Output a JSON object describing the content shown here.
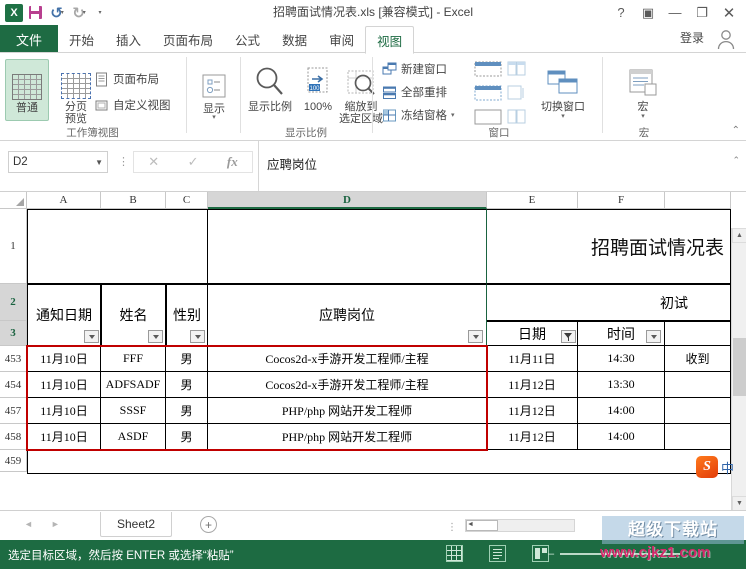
{
  "window": {
    "title": "招聘面试情况表.xls  [兼容模式] - Excel",
    "quick_access": [
      {
        "name": "save",
        "label": "保存"
      },
      {
        "name": "undo",
        "label": "撤销"
      },
      {
        "name": "redo",
        "label": "恢复"
      },
      {
        "name": "customize",
        "label": "自定义快速访问工具栏"
      }
    ],
    "controls": {
      "help": "?",
      "ribbon_display": "▣",
      "minimize": "—",
      "maximize": "❐",
      "close": "✕"
    }
  },
  "ribbon": {
    "file_tab": "文件",
    "tabs": [
      "开始",
      "插入",
      "页面布局",
      "公式",
      "数据",
      "审阅",
      "视图"
    ],
    "active_tab": "视图",
    "signin": "登录",
    "groups": [
      {
        "name": "workbook-views",
        "label": "工作簿视图",
        "buttons": [
          {
            "label": "普通",
            "selected": true
          },
          {
            "label": "分页\n预览",
            "selected": false
          }
        ],
        "small_items": [
          {
            "label": "页面布局",
            "icon": "page-layout-icon"
          },
          {
            "label": "自定义视图",
            "icon": "custom-view-icon"
          }
        ]
      },
      {
        "name": "show",
        "label": "",
        "buttons": [
          {
            "label": "显示",
            "selected": false
          }
        ]
      },
      {
        "name": "zoom-group",
        "label": "显示比例",
        "buttons": [
          {
            "label": "显示比例",
            "selected": false
          },
          {
            "label": "100%",
            "selected": false
          },
          {
            "label": "缩放到\n选定区域",
            "selected": false
          }
        ]
      },
      {
        "name": "window-group",
        "label": "窗口",
        "small_items": [
          {
            "label": "新建窗口",
            "icon": "new-window-icon"
          },
          {
            "label": "全部重排",
            "icon": "arrange-all-icon"
          },
          {
            "label": "冻结窗格",
            "icon": "freeze-panes-icon"
          }
        ],
        "buttons": [
          {
            "label": "切换窗口",
            "selected": false
          }
        ]
      },
      {
        "name": "macro-group",
        "label": "宏",
        "buttons": [
          {
            "label": "宏",
            "selected": false
          }
        ]
      }
    ]
  },
  "formula_bar": {
    "name_box": "D2",
    "cancel": "✕",
    "enter": "✓",
    "fx": "fx",
    "content": "应聘岗位",
    "expand": "⌃"
  },
  "grid": {
    "columns": [
      "A",
      "B",
      "C",
      "D",
      "E",
      "F"
    ],
    "selected_column": "D",
    "row_numbers": [
      "1",
      "2",
      "3",
      "453",
      "454",
      "457",
      "458",
      "459"
    ],
    "selected_rows": [
      "2",
      "3"
    ],
    "sheet_title": "招聘面试情况表",
    "group_header": "初试",
    "header_row": [
      "通知日期",
      "姓名",
      "性别",
      "应聘岗位",
      "日期",
      "时间"
    ],
    "filtered_column": "日期",
    "rows": [
      {
        "row": "453",
        "notify_date": "11月10日",
        "name": "FFF",
        "gender": "男",
        "position": "Cocos2d-x手游开发工程师/主程",
        "date": "11月11日",
        "time": "14:30",
        "note": "收到"
      },
      {
        "row": "454",
        "notify_date": "11月10日",
        "name": "ADFSADF",
        "gender": "男",
        "position": "Cocos2d-x手游开发工程师/主程",
        "date": "11月12日",
        "time": "13:30",
        "note": ""
      },
      {
        "row": "457",
        "notify_date": "11月10日",
        "name": "SSSF",
        "gender": "男",
        "position": "PHP/php 网站开发工程师",
        "date": "11月12日",
        "time": "14:00",
        "note": ""
      },
      {
        "row": "458",
        "notify_date": "11月10日",
        "name": "ASDF",
        "gender": "男",
        "position": "PHP/php 网站开发工程师",
        "date": "11月12日",
        "time": "14:00",
        "note": ""
      }
    ]
  },
  "sheet_bar": {
    "prev": "◄",
    "next": "►",
    "tabs": [
      "Sheet2"
    ],
    "active_tab": "Sheet2",
    "add_sheet": "+"
  },
  "status_bar": {
    "message": "选定目标区域，然后按 ENTER 或选择“粘贴”",
    "views": [
      "普通",
      "页面布局",
      "分页预览"
    ],
    "zoom_minus": "–"
  },
  "watermark": {
    "line1": "超级下载站",
    "line2": "www.cjkz1.com"
  },
  "ime": {
    "logo": "S",
    "mode": "中"
  },
  "colors": {
    "accent_green": "#1d6b42",
    "file_tab_green": "#1e6b43",
    "marquee_red": "#c00000",
    "selection_gray": "#d6d6d6"
  }
}
